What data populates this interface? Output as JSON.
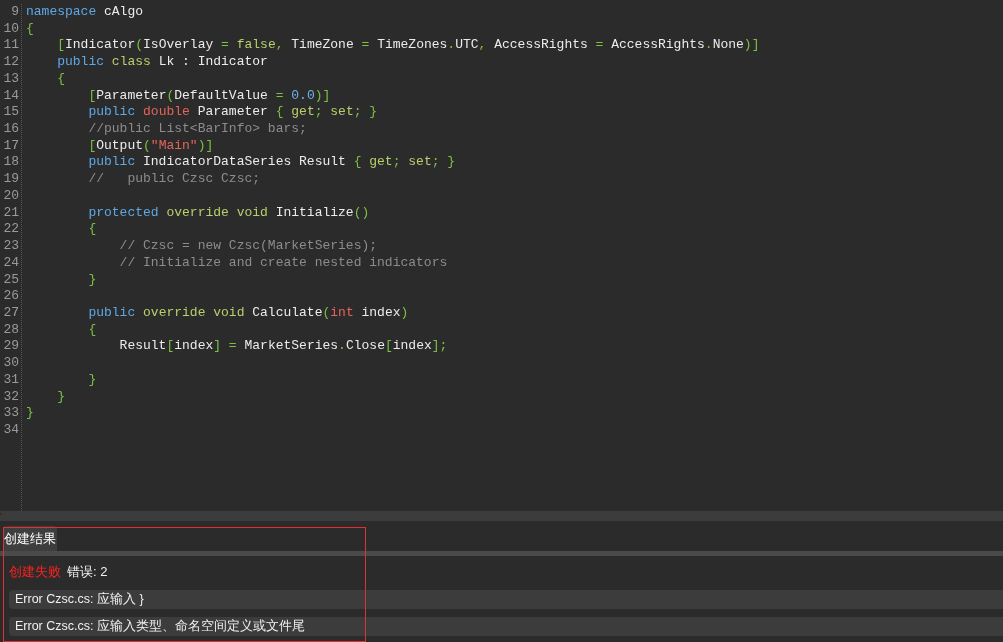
{
  "editor": {
    "lines": [
      {
        "number": "9",
        "tokens": [
          {
            "kind": "kw",
            "text": "namespace"
          },
          {
            "kind": "plain",
            "text": " cAlgo"
          }
        ]
      },
      {
        "number": "10",
        "tokens": [
          {
            "kind": "punct",
            "text": "{"
          }
        ]
      },
      {
        "number": "11",
        "tokens": [
          {
            "kind": "punct",
            "text": "    ["
          },
          {
            "kind": "plain",
            "text": "Indicator"
          },
          {
            "kind": "punct",
            "text": "("
          },
          {
            "kind": "plain",
            "text": "IsOverlay "
          },
          {
            "kind": "punct",
            "text": "= "
          },
          {
            "kind": "kw2",
            "text": "false"
          },
          {
            "kind": "punct",
            "text": ","
          },
          {
            "kind": "plain",
            "text": " TimeZone "
          },
          {
            "kind": "punct",
            "text": "="
          },
          {
            "kind": "plain",
            "text": " TimeZones"
          },
          {
            "kind": "punct",
            "text": "."
          },
          {
            "kind": "plain",
            "text": "UTC"
          },
          {
            "kind": "punct",
            "text": ","
          },
          {
            "kind": "plain",
            "text": " AccessRights "
          },
          {
            "kind": "punct",
            "text": "="
          },
          {
            "kind": "plain",
            "text": " AccessRights"
          },
          {
            "kind": "punct",
            "text": "."
          },
          {
            "kind": "plain",
            "text": "None"
          },
          {
            "kind": "punct",
            "text": ")]"
          }
        ]
      },
      {
        "number": "12",
        "tokens": [
          {
            "kind": "kw",
            "text": "    public "
          },
          {
            "kind": "kw2",
            "text": "class"
          },
          {
            "kind": "plain",
            "text": " Lk : Indicator"
          }
        ]
      },
      {
        "number": "13",
        "tokens": [
          {
            "kind": "punct",
            "text": "    {"
          }
        ]
      },
      {
        "number": "14",
        "tokens": [
          {
            "kind": "punct",
            "text": "        ["
          },
          {
            "kind": "plain",
            "text": "Parameter"
          },
          {
            "kind": "punct",
            "text": "("
          },
          {
            "kind": "plain",
            "text": "DefaultValue "
          },
          {
            "kind": "punct",
            "text": "= "
          },
          {
            "kind": "number",
            "text": "0.0"
          },
          {
            "kind": "punct",
            "text": ")]"
          }
        ]
      },
      {
        "number": "15",
        "tokens": [
          {
            "kind": "kw",
            "text": "        public "
          },
          {
            "kind": "type",
            "text": "double"
          },
          {
            "kind": "plain",
            "text": " Parameter "
          },
          {
            "kind": "punct",
            "text": "{ "
          },
          {
            "kind": "kw2",
            "text": "get"
          },
          {
            "kind": "punct",
            "text": "; "
          },
          {
            "kind": "kw2",
            "text": "set"
          },
          {
            "kind": "punct",
            "text": "; }"
          }
        ]
      },
      {
        "number": "16",
        "tokens": [
          {
            "kind": "comment",
            "text": "        //public List<BarInfo> bars;"
          }
        ]
      },
      {
        "number": "17",
        "tokens": [
          {
            "kind": "punct",
            "text": "        ["
          },
          {
            "kind": "plain",
            "text": "Output"
          },
          {
            "kind": "punct",
            "text": "("
          },
          {
            "kind": "string",
            "text": "\"Main\""
          },
          {
            "kind": "punct",
            "text": ")]"
          }
        ]
      },
      {
        "number": "18",
        "tokens": [
          {
            "kind": "kw",
            "text": "        public"
          },
          {
            "kind": "plain",
            "text": " IndicatorDataSeries Result "
          },
          {
            "kind": "punct",
            "text": "{ "
          },
          {
            "kind": "kw2",
            "text": "get"
          },
          {
            "kind": "punct",
            "text": "; "
          },
          {
            "kind": "kw2",
            "text": "set"
          },
          {
            "kind": "punct",
            "text": "; }"
          }
        ]
      },
      {
        "number": "19",
        "tokens": [
          {
            "kind": "comment",
            "text": "        //   public Czsc Czsc;"
          }
        ]
      },
      {
        "number": "20"
      },
      {
        "number": "21",
        "tokens": [
          {
            "kind": "kw",
            "text": "        protected "
          },
          {
            "kind": "kw2",
            "text": "override void"
          },
          {
            "kind": "plain",
            "text": " Initialize"
          },
          {
            "kind": "punct",
            "text": "()"
          }
        ]
      },
      {
        "number": "22",
        "tokens": [
          {
            "kind": "punct",
            "text": "        {"
          }
        ]
      },
      {
        "number": "23",
        "tokens": [
          {
            "kind": "comment",
            "text": "            // Czsc = new Czsc(MarketSeries);"
          }
        ]
      },
      {
        "number": "24",
        "tokens": [
          {
            "kind": "comment",
            "text": "            // Initialize and create nested indicators"
          }
        ]
      },
      {
        "number": "25",
        "tokens": [
          {
            "kind": "punct",
            "text": "        }"
          }
        ]
      },
      {
        "number": "26"
      },
      {
        "number": "27",
        "tokens": [
          {
            "kind": "kw",
            "text": "        public "
          },
          {
            "kind": "kw2",
            "text": "override void"
          },
          {
            "kind": "plain",
            "text": " Calculate"
          },
          {
            "kind": "punct",
            "text": "("
          },
          {
            "kind": "type",
            "text": "int"
          },
          {
            "kind": "plain",
            "text": " index"
          },
          {
            "kind": "punct",
            "text": ")"
          }
        ]
      },
      {
        "number": "28",
        "tokens": [
          {
            "kind": "punct",
            "text": "        {"
          }
        ]
      },
      {
        "number": "29",
        "tokens": [
          {
            "kind": "plain",
            "text": "            Result"
          },
          {
            "kind": "punct",
            "text": "["
          },
          {
            "kind": "plain",
            "text": "index"
          },
          {
            "kind": "punct",
            "text": "] = "
          },
          {
            "kind": "plain",
            "text": "MarketSeries"
          },
          {
            "kind": "punct",
            "text": "."
          },
          {
            "kind": "plain",
            "text": "Close"
          },
          {
            "kind": "punct",
            "text": "["
          },
          {
            "kind": "plain",
            "text": "index"
          },
          {
            "kind": "punct",
            "text": "];"
          }
        ]
      },
      {
        "number": "30"
      },
      {
        "number": "31",
        "tokens": [
          {
            "kind": "punct",
            "text": "        }"
          }
        ]
      },
      {
        "number": "32",
        "tokens": [
          {
            "kind": "punct",
            "text": "    }"
          }
        ]
      },
      {
        "number": "33",
        "tokens": [
          {
            "kind": "punct",
            "text": "}"
          }
        ]
      },
      {
        "number": "34"
      }
    ]
  },
  "results": {
    "tabs": [
      {
        "label": "创建结果",
        "selected": true
      }
    ],
    "status": "创建失败",
    "summary": "错误: 2",
    "errors": [
      "Error Czsc.cs: 应输入 }",
      "Error Czsc.cs: 应输入类型、命名空间定义或文件尾"
    ]
  }
}
